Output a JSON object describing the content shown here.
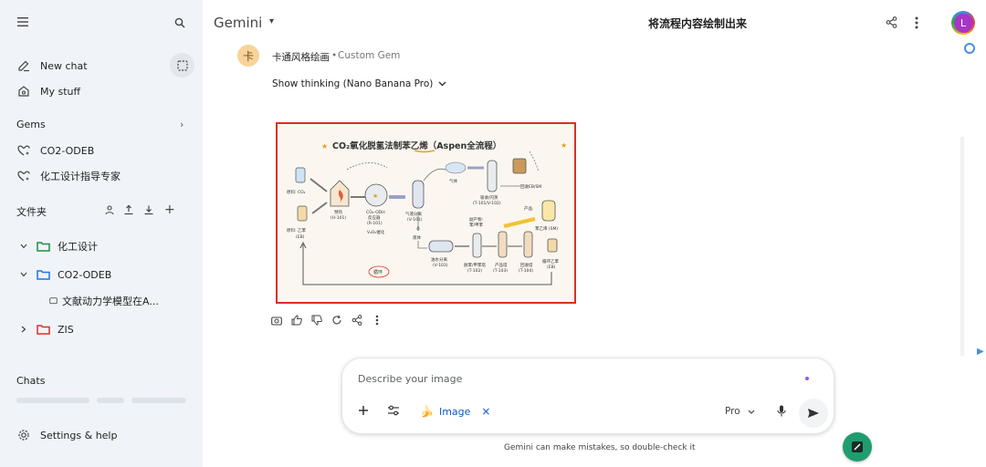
{
  "sidebar": {
    "new_chat": "New chat",
    "my_stuff": "My stuff",
    "gems_label": "Gems",
    "gems": [
      "CO2-ODEB",
      "化工设计指导专家"
    ],
    "files_label": "文件夹",
    "folders": [
      {
        "name": "化工设计",
        "color": "#1e8e3e"
      },
      {
        "name": "CO2-ODEB",
        "color": "#1a73e8"
      },
      {
        "name": "ZIS",
        "color": "#d93025"
      }
    ],
    "sub_item": "文献动力学模型在A...",
    "chats_label": "Chats",
    "settings": "Settings & help"
  },
  "topbar": {
    "app_title": "Gemini",
    "chat_title": "将流程内容绘制出来",
    "avatar_letter": "L"
  },
  "message": {
    "gem_initial": "卡",
    "gem_name": "卡通风格绘画",
    "separator": "•",
    "gem_type": "Custom Gem",
    "show_thinking": "Show thinking (Nano Banana Pro)"
  },
  "image": {
    "title": "CO₂氧化脱氢法制苯乙烯（Aspen全流程）",
    "labels": {
      "feed1": "原料: CO₂",
      "feed2": "原料: 乙苯",
      "feed2b": "(EB)",
      "preheat": "预热",
      "preheat_id": "(H-101)",
      "reactor": "CO₂-ODH",
      "reactor2": "反应器",
      "reactor_id": "(R-101)",
      "catalyst": "V₂O₅催化",
      "gasliq": "气液分离",
      "gasliq_id": "(V-101)",
      "gas": "气体",
      "absorb": "吸收/闪蒸",
      "absorb_id": "(T-101/V-102)",
      "recycle_ebsm": "回收EB/SM",
      "liquid": "液体",
      "oilwater": "油水分离",
      "oilwater_id": "(V-103)",
      "byproduct": "副产物:",
      "byproduct2": "苯/甲苯",
      "product": "产品:",
      "sm": "苯乙烯 (SM)",
      "col1": "脱苯/甲苯塔",
      "col1_id": "(T-102)",
      "col2": "产品塔",
      "col2_id": "(T-103)",
      "col3": "回收塔",
      "col3_id": "(T-104)",
      "recycle_eb": "循环乙苯",
      "recycle_eb2": "(EB)",
      "loop": "循环"
    }
  },
  "composer": {
    "placeholder": "Describe your image",
    "chip_label": "Image",
    "mode": "Pro",
    "disclaimer": "Gemini can make mistakes, so double-check it"
  },
  "colors": {
    "sidebar_bg": "#f0f4f9",
    "accent": "#0b57d0",
    "highlight_border": "#d93025",
    "fab": "#1f9d6e"
  }
}
